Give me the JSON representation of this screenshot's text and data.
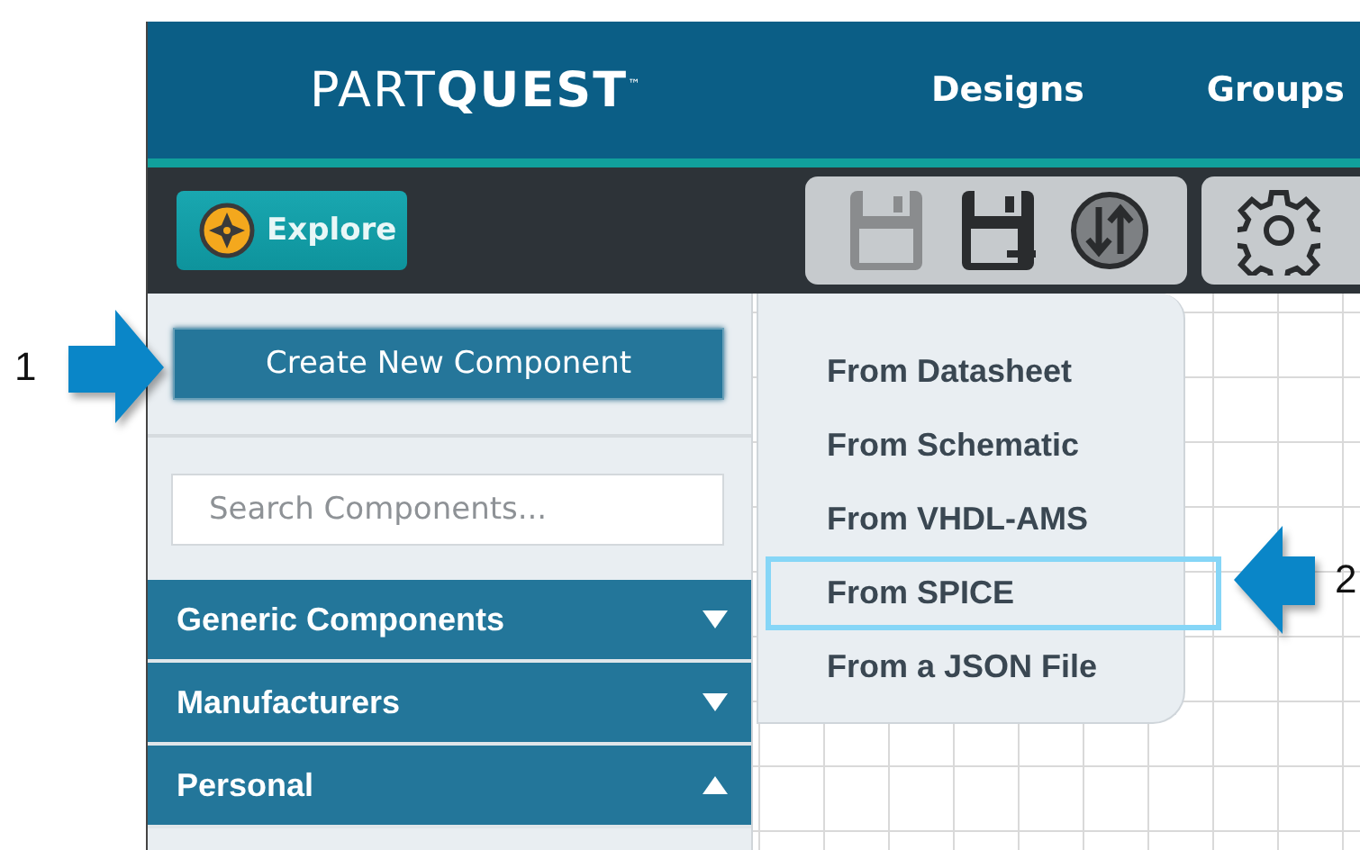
{
  "header": {
    "logo": "PART**QUEST**$^{™}$",
    "nav": [
      "Designs",
      "Groups"
    ]
  },
  "toolbar": {
    "explore": "Explore",
    "tools": [
      {
        "kind": "save",
        "disabled": true
      },
      {
        "kind": "save-as",
        "disabled": false
      },
      {
        "kind": "sync",
        "disabled": false
      },
      {
        "kind": "settings",
        "disabled": false
      }
    ]
  },
  "sidebar": {
    "create_button": "Create New Component",
    "search": {
      "placeholder": "Search Components..."
    },
    "sections": [
      {
        "label": "Generic Components",
        "expanded": false
      },
      {
        "label": "Manufacturers",
        "expanded": false
      },
      {
        "label": "Personal",
        "expanded": true
      }
    ]
  },
  "create_menu": {
    "items": [
      {
        "label": "From Datasheet",
        "selected": false
      },
      {
        "label": "From Schematic",
        "selected": false
      },
      {
        "label": "From VHDL-AMS",
        "selected": false
      },
      {
        "label": "From SPICE",
        "selected": true
      },
      {
        "label": "From a JSON File",
        "selected": false
      }
    ]
  },
  "callouts": [
    {
      "label": "1"
    },
    {
      "label": "2"
    }
  ]
}
